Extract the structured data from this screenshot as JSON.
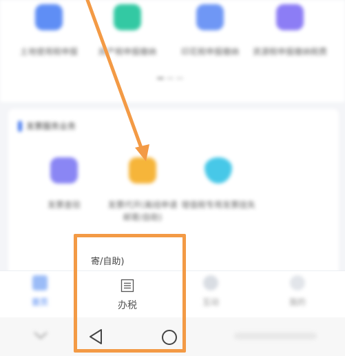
{
  "top_services": [
    {
      "icon": "document-icon",
      "color": "#5f8ef5",
      "label": "土地使用税申报"
    },
    {
      "icon": "document-icon",
      "color": "#33c9a3",
      "label": "房产税申报缴纳"
    },
    {
      "icon": "document-icon",
      "color": "#6f97f5",
      "label": "印花税申报缴纳"
    },
    {
      "icon": "document-icon",
      "color": "#8c7df5",
      "label": "资源税申报缴纳税费"
    }
  ],
  "section": {
    "title": "发票服务业务",
    "items": [
      {
        "icon": "invoice-icon",
        "color": "#8a86f4",
        "label": "发票查验"
      },
      {
        "icon": "invoice-icon",
        "color": "#f6b53a",
        "label": "发票代开(离线申请邮寄/自助)"
      },
      {
        "icon": "invoice-icon",
        "color": "#47c8e8",
        "label": "增值税专用发票挂失"
      }
    ]
  },
  "overlay_text": {
    "partial_label": "寄/自助)"
  },
  "tabs": [
    {
      "name": "home",
      "icon": "home-icon",
      "label": "首页",
      "active": true
    },
    {
      "name": "tax",
      "icon": "list-icon",
      "label": "办税",
      "active": false
    },
    {
      "name": "consult",
      "icon": "chat-icon",
      "label": "互动",
      "active": false
    },
    {
      "name": "me",
      "icon": "user-icon",
      "label": "我的",
      "active": false
    }
  ],
  "colors": {
    "highlight": "#f39a45",
    "accent": "#3a78f2"
  }
}
